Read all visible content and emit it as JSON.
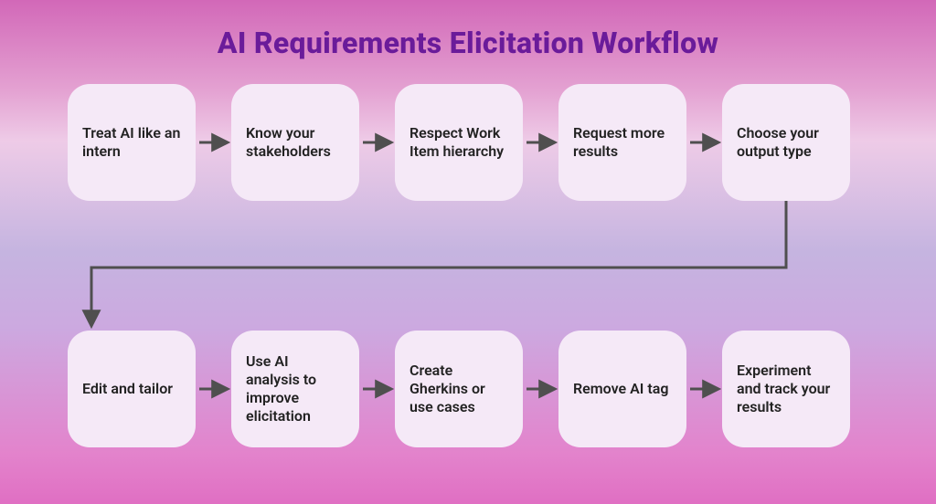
{
  "title": "AI Requirements Elicitation Workflow",
  "steps": [
    "Treat AI like an intern",
    "Know your stakeholders",
    "Respect Work Item hierarchy",
    "Request more results",
    "Choose your output type",
    "Edit and tailor",
    "Use AI analysis to improve elicitation",
    "Create Gherkins or use cases",
    "Remove AI tag",
    "Experiment and track your results"
  ],
  "colors": {
    "arrow": "#4f4f4f",
    "card_bg": "#f5e9f7",
    "title": "#6a1b9a"
  }
}
